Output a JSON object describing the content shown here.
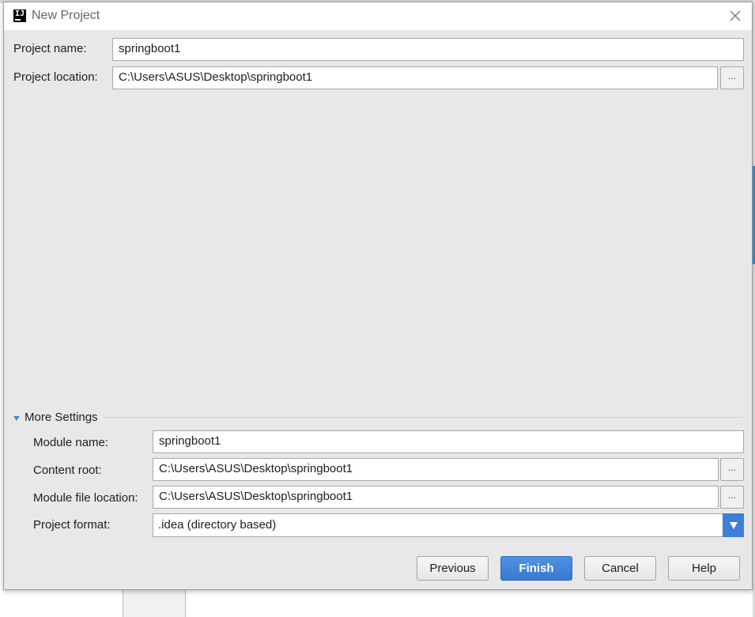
{
  "window": {
    "title": "New Project",
    "app_icon_glyph": "IJ"
  },
  "project": {
    "name_label": "Project name:",
    "name_value": "springboot1",
    "location_label": "Project location:",
    "location_value": "C:\\Users\\ASUS\\Desktop\\springboot1",
    "browse_label": "..."
  },
  "more_settings": {
    "label": "More Settings",
    "expanded": true,
    "module_name_label": "Module name:",
    "module_name_value": "springboot1",
    "content_root_label": "Content root:",
    "content_root_value": "C:\\Users\\ASUS\\Desktop\\springboot1",
    "module_file_label": "Module file location:",
    "module_file_value": "C:\\Users\\ASUS\\Desktop\\springboot1",
    "format_label": "Project format:",
    "format_value": ".idea (directory based)",
    "browse_label": "..."
  },
  "buttons": {
    "previous": "Previous",
    "finish": "Finish",
    "cancel": "Cancel",
    "help": "Help"
  },
  "icons": {
    "close": "close-icon",
    "app": "intellij-icon",
    "expand": "triangle-down-icon",
    "dropdown": "chevron-down-icon"
  },
  "colors": {
    "accent": "#3d7fd6",
    "dialog_bg": "#e8e8e8"
  }
}
